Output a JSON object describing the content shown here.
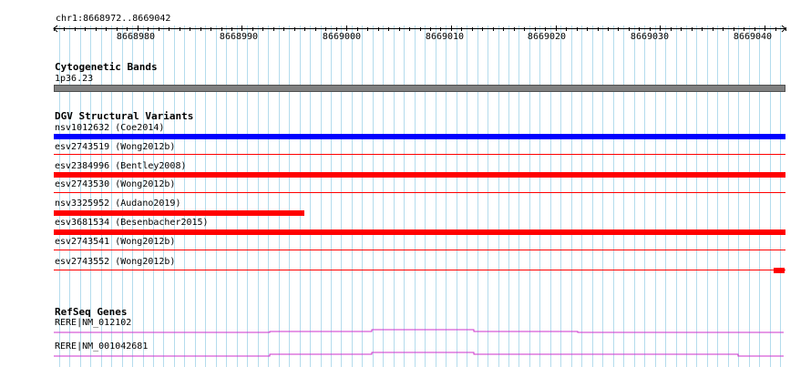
{
  "coordinate_label": "chr1:8668972..8669042",
  "ruler": {
    "start": 8668972,
    "end": 8669042,
    "tick_labels": [
      "8668980",
      "8668990",
      "8669000",
      "8669010",
      "8669020",
      "8669030",
      "8669040"
    ]
  },
  "tracks": {
    "cytoband": {
      "title": "Cytogenetic Bands",
      "band_label": "1p36.23",
      "color": "#808080"
    },
    "dgv": {
      "title": "DGV Structural Variants",
      "features": [
        {
          "label": "nsv1012632 (Coe2014)",
          "color": "#0000ff",
          "start": 8668972,
          "end": 8669042
        },
        {
          "label": "esv2743519 (Wong2012b)",
          "color": "#ff0000",
          "start": null,
          "end": null
        },
        {
          "label": "esv2384996 (Bentley2008)",
          "color": "#ff0000",
          "start": 8668972,
          "end": 8669042
        },
        {
          "label": "esv2743530 (Wong2012b)",
          "color": "#ff0000",
          "start": null,
          "end": null
        },
        {
          "label": "nsv3325952 (Audano2019)",
          "color": "#ff0000",
          "start": 8668972,
          "end": 8668996
        },
        {
          "label": "esv3681534 (Besenbacher2015)",
          "color": "#ff0000",
          "start": 8668972,
          "end": 8669042
        },
        {
          "label": "esv2743541 (Wong2012b)",
          "color": "#ff0000",
          "start": null,
          "end": null
        },
        {
          "label": "esv2743552 (Wong2012b)",
          "color": "#ff0000",
          "start": 8669041,
          "end": 8669042
        }
      ]
    },
    "refseq": {
      "title": "RefSeq Genes",
      "color": "#cc33cc",
      "genes": [
        {
          "label": "RERE|NM_012102"
        },
        {
          "label": "RERE|NM_001042681"
        }
      ]
    }
  }
}
